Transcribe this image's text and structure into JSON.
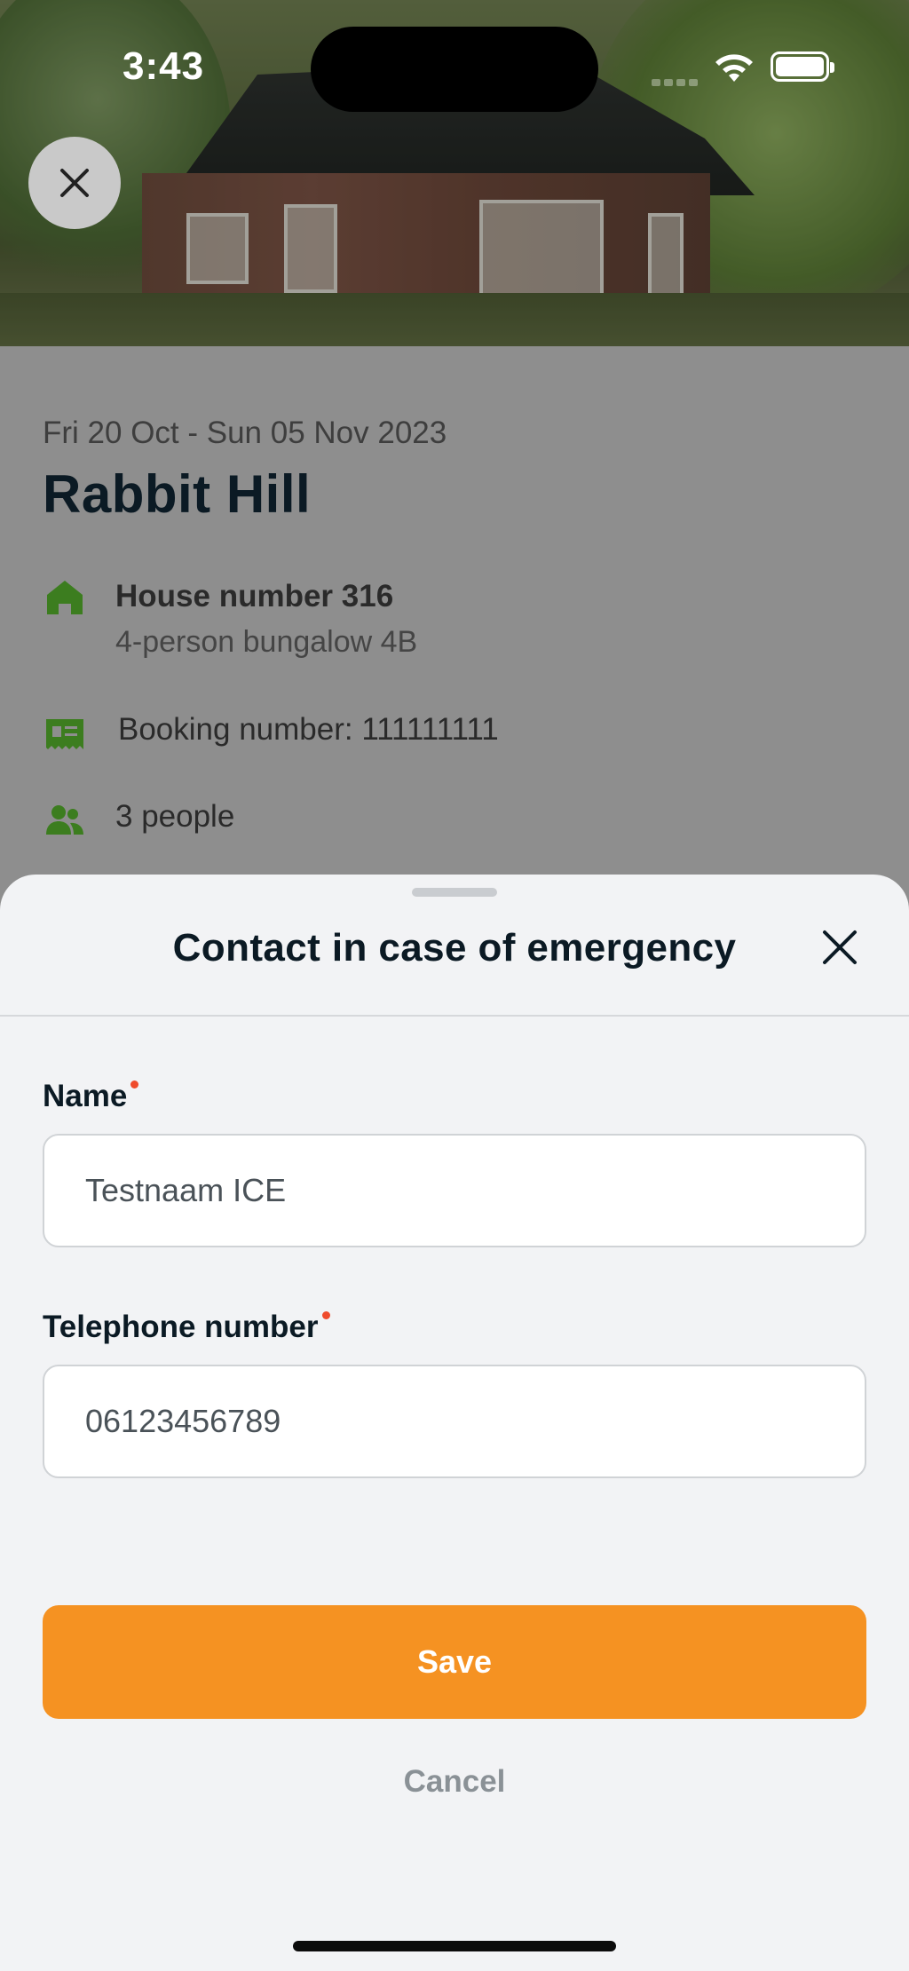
{
  "status_bar": {
    "time": "3:43"
  },
  "booking": {
    "dates": "Fri 20 Oct - Sun 05 Nov 2023",
    "park_name": "Rabbit Hill",
    "house_title": "House number 316",
    "house_type": "4-person bungalow 4B",
    "booking_number": "Booking number: 111111111",
    "people": "3 people"
  },
  "sheet": {
    "title": "Contact in case of emergency",
    "name_label": "Name",
    "name_value": "Testnaam ICE",
    "phone_label": "Telephone number",
    "phone_value": "06123456789",
    "save_label": "Save",
    "cancel_label": "Cancel"
  },
  "colors": {
    "accent": "#f59222",
    "required_dot": "#ef4b2c",
    "icon_green": "#3c7d1f",
    "heading": "#0b1a24"
  }
}
